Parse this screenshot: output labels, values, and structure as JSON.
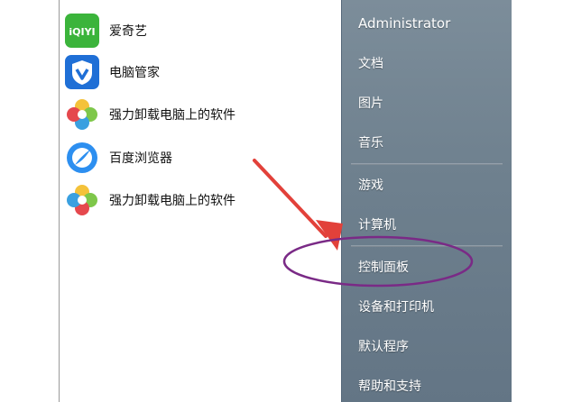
{
  "programs": [
    {
      "label": "爱奇艺",
      "icon": "iqiyi-icon"
    },
    {
      "label": "电脑管家",
      "icon": "pc-manager-shield-icon"
    },
    {
      "label": "强力卸载电脑上的软件",
      "icon": "uninstaller-flower-icon"
    },
    {
      "label": "百度浏览器",
      "icon": "baidu-browser-icon"
    },
    {
      "label": "强力卸载电脑上的软件",
      "icon": "uninstaller-flower-icon"
    }
  ],
  "iqiyi_icon_text": "iQIYI",
  "right_pane": {
    "user": "Administrator",
    "items": [
      "文档",
      "图片",
      "音乐",
      "游戏",
      "计算机",
      "控制面板",
      "设备和打印机",
      "默认程序",
      "帮助和支持"
    ]
  },
  "colors": {
    "arrow": "#e2413a",
    "highlight_ellipse": "#7a2a86",
    "right_pane": "#6e808e"
  }
}
